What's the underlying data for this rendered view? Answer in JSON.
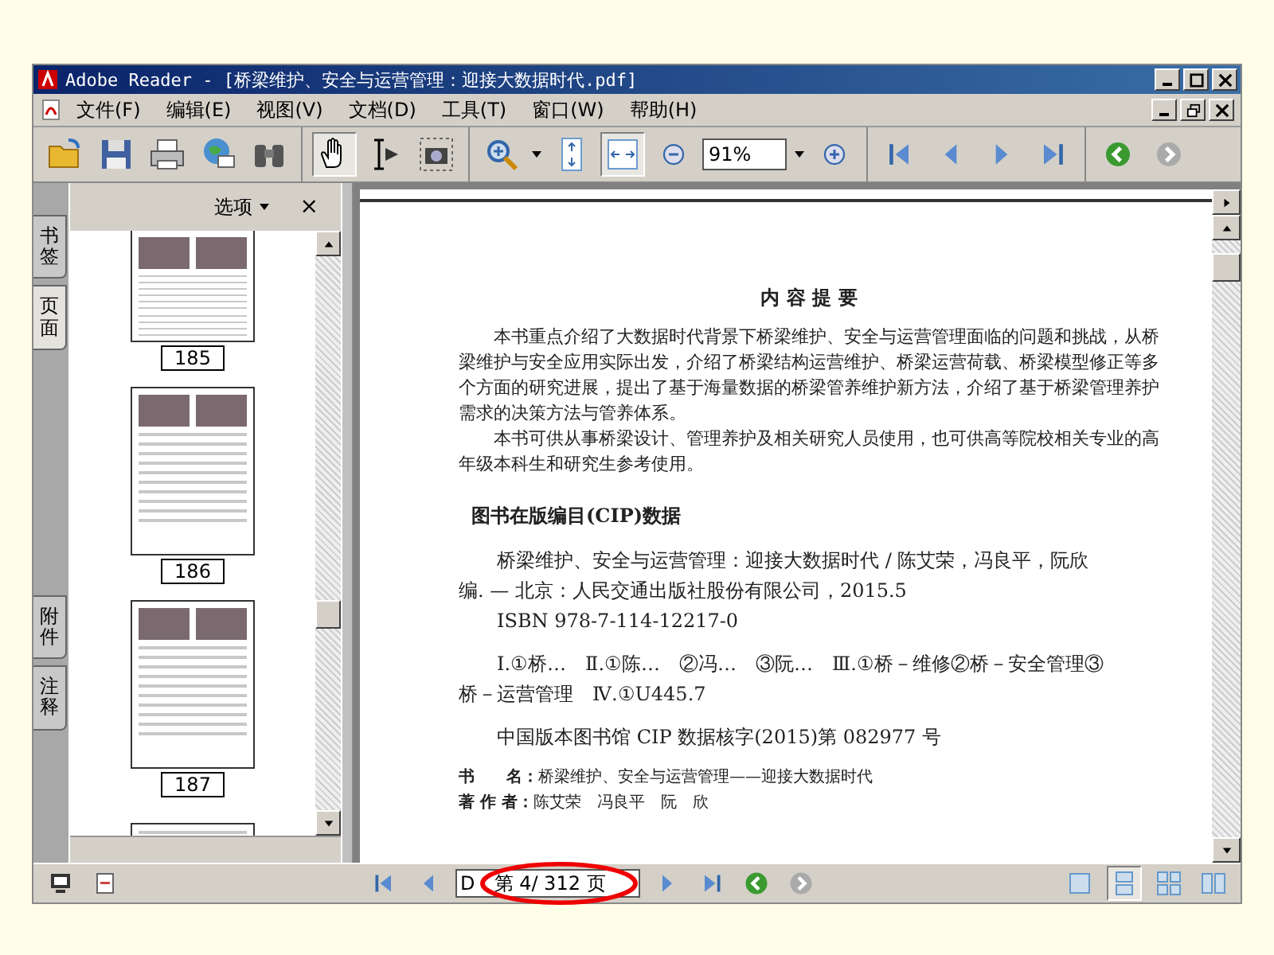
{
  "window": {
    "title": "Adobe Reader - [桥梁维护、安全与运营管理：迎接大数据时代.pdf]"
  },
  "menu": [
    {
      "label": "文件(F)"
    },
    {
      "label": "编辑(E)"
    },
    {
      "label": "视图(V)"
    },
    {
      "label": "文档(D)"
    },
    {
      "label": "工具(T)"
    },
    {
      "label": "窗口(W)"
    },
    {
      "label": "帮助(H)"
    }
  ],
  "toolbar": {
    "tools": [
      {
        "selected": true
      },
      {
        "selected": false
      },
      {
        "selected": false
      }
    ],
    "fit": [
      {
        "selected": false
      },
      {
        "selected": true
      }
    ],
    "zoom": "91%",
    "history": [
      {
        "disabled": false
      },
      {
        "disabled": true
      }
    ]
  },
  "side_tabs": [
    {
      "label": "书签",
      "selected": false
    },
    {
      "label": "页面",
      "selected": true
    },
    {
      "label": "附件",
      "selected": false
    },
    {
      "label": "注释",
      "selected": false
    }
  ],
  "panel": {
    "options": "选项",
    "close": "×",
    "thumbnails": [
      {
        "label": "185"
      },
      {
        "label": "186"
      },
      {
        "label": "187"
      }
    ]
  },
  "document": {
    "heading": "内 容 提 要",
    "paragraphs": [
      "本书重点介绍了大数据时代背景下桥梁维护、安全与运营管理面临的问题和挑战，从桥梁维护与安全应用实际出发，介绍了桥梁结构运营维护、桥梁运营荷载、桥梁模型修正等多个方面的研究进展，提出了基于海量数据的桥梁管养维护新方法，介绍了基于桥梁管理养护需求的决策方法与管养体系。",
      "本书可供从事桥梁设计、管理养护及相关研究人员使用，也可供高等院校相关专业的高年级本科生和研究生参考使用。"
    ],
    "cip_heading": "图书在版编目(CIP)数据",
    "cip_blocks": [
      "桥梁维护、安全与运营管理：迎接大数据时代 / 陈艾荣，冯良平，阮欣编. — 北京：人民交通出版社股份有限公司，2015.5",
      "ISBN 978-7-114-12217-0",
      "Ⅰ.①桥…　Ⅱ.①陈…　②冯…　③阮…　Ⅲ.①桥－维修②桥－安全管理③桥－运营管理　Ⅳ.①U445.7",
      "中国版本图书馆 CIP 数据核字(2015)第 082977 号"
    ],
    "credits": [
      {
        "key": "书　　名：",
        "value": "桥梁维护、安全与运营管理——迎接大数据时代"
      },
      {
        "key": "著 作 者：",
        "value": "陈艾荣　冯良平　阮　欣"
      }
    ]
  },
  "status_bar": {
    "page_field": "D",
    "page_label": "第 4/ 312 页",
    "history": [
      {
        "disabled": false
      },
      {
        "disabled": true
      }
    ],
    "view_modes": [
      {
        "selected": false
      },
      {
        "selected": true
      },
      {
        "selected": false
      },
      {
        "selected": false
      }
    ]
  }
}
